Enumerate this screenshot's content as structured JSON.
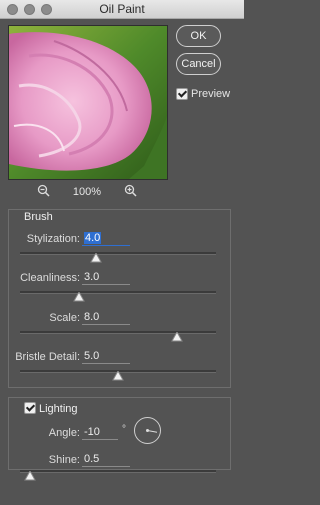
{
  "window": {
    "title": "Oil Paint"
  },
  "buttons": {
    "ok": "OK",
    "cancel": "Cancel"
  },
  "preview": {
    "label": "Preview",
    "checked": true
  },
  "zoom": {
    "value": "100%"
  },
  "brush": {
    "legend": "Brush",
    "controls": [
      {
        "label": "Stylization:",
        "value": "4.0",
        "fraction": 0.39
      },
      {
        "label": "Cleanliness:",
        "value": "3.0",
        "fraction": 0.3
      },
      {
        "label": "Scale:",
        "value": "8.0",
        "fraction": 0.8
      },
      {
        "label": "Bristle Detail:",
        "value": "5.0",
        "fraction": 0.5
      }
    ]
  },
  "lighting": {
    "legend": "Lighting",
    "checked": true,
    "angle": {
      "label": "Angle:",
      "value": "-10",
      "unit": "°"
    },
    "shine": {
      "label": "Shine:",
      "value": "0.5",
      "fraction": 0.05
    }
  },
  "colors": {
    "accent": "#2f6fd1",
    "panel": "#535353"
  }
}
